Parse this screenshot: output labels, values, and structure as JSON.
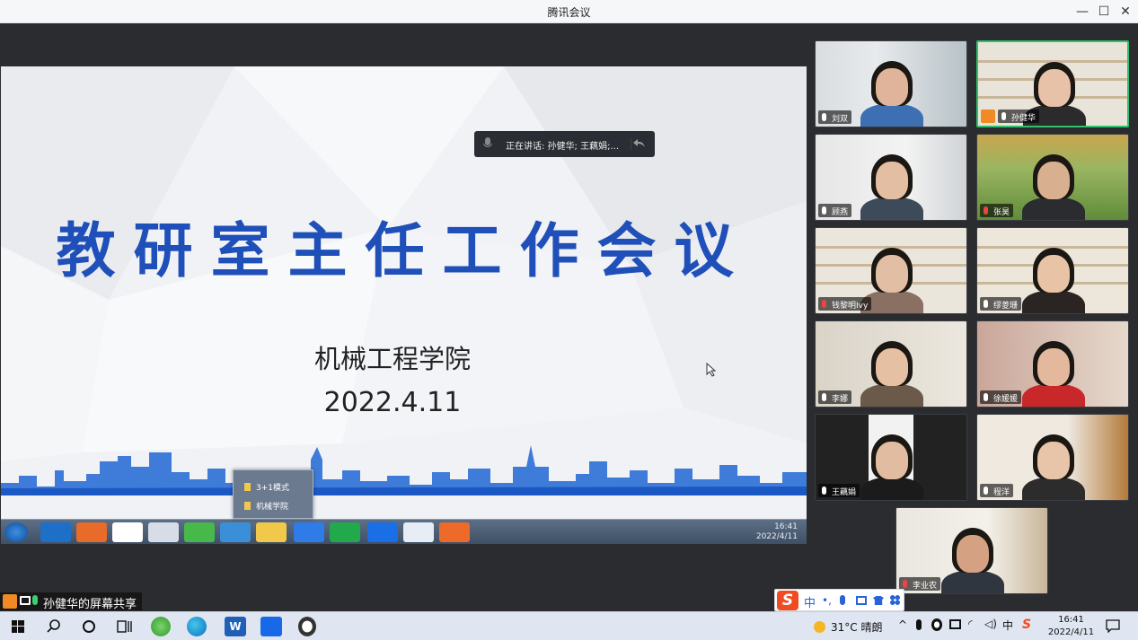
{
  "window": {
    "title": "腾讯会议",
    "minimize": "—",
    "maximize": "☐",
    "close": "✕"
  },
  "slide": {
    "title": "教研室主任工作会议",
    "subtitle": "机械工程学院",
    "date": "2022.4.11"
  },
  "speaking": {
    "text": "正在讲话: 孙健华; 王藕娟;..."
  },
  "jump_list": {
    "items": [
      "3+1模式",
      "机械学院"
    ]
  },
  "inner_taskbar": {
    "time": "16:41",
    "date": "2022/4/11"
  },
  "screen_share": {
    "label": "孙健华的屏幕共享"
  },
  "participants": [
    {
      "name": "刘双",
      "muted": false,
      "host": false,
      "active": false
    },
    {
      "name": "孙健华",
      "muted": false,
      "host": true,
      "active": true
    },
    {
      "name": "顾燕",
      "muted": false,
      "host": false,
      "active": false
    },
    {
      "name": "张昊",
      "muted": true,
      "host": false,
      "active": false
    },
    {
      "name": "钱黎明Ivy",
      "muted": true,
      "host": false,
      "active": false
    },
    {
      "name": "缪菱珊",
      "muted": false,
      "host": false,
      "active": false
    },
    {
      "name": "李娜",
      "muted": false,
      "host": false,
      "active": false
    },
    {
      "name": "徐媛媛",
      "muted": false,
      "host": false,
      "active": false
    },
    {
      "name": "王藕娟",
      "muted": false,
      "host": false,
      "active": false
    },
    {
      "name": "程洋",
      "muted": false,
      "host": false,
      "active": false
    },
    {
      "name": "李业农",
      "muted": true,
      "host": false,
      "active": false
    }
  ],
  "ime": {
    "mode": "中",
    "icons": [
      "•,",
      "🎤",
      "▦",
      "👕",
      "▪▪"
    ]
  },
  "taskbar": {
    "weather_temp": "31°C",
    "weather_desc": "晴朗",
    "time": "16:41",
    "date": "2022/4/11",
    "icons": [
      "windows-start-icon",
      "search-icon",
      "cortana-icon",
      "task-view-icon",
      "ie-browser-icon",
      "edge-browser-icon",
      "word-icon",
      "tencent-meeting-icon",
      "qq-icon"
    ]
  },
  "colors": {
    "slide_title": "#1f4fb8",
    "active_speaker": "#2ec26a",
    "host_badge": "#f08a24"
  }
}
